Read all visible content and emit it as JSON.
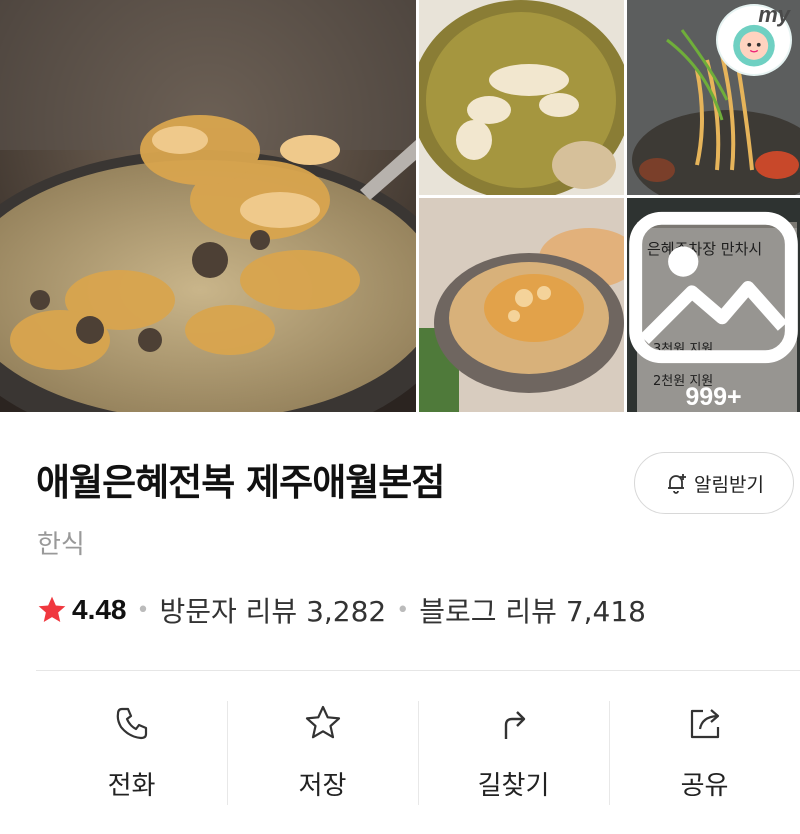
{
  "photos": {
    "more_count": "999+",
    "badge_text": "my",
    "sign_lines": [
      "은혜주차장 만차시",
      "3천원 지원",
      "2천원 지원"
    ]
  },
  "place": {
    "name": "애월은혜전복 제주애월본점",
    "category": "한식",
    "rating": "4.48",
    "visitor_reviews": "방문자 리뷰 3,282",
    "blog_reviews": "블로그 리뷰 7,418"
  },
  "alarm_button": {
    "label": "알림받기",
    "icon": "bell-plus-icon"
  },
  "actions": [
    {
      "label": "전화",
      "icon": "phone-icon"
    },
    {
      "label": "저장",
      "icon": "star-outline-icon"
    },
    {
      "label": "길찾기",
      "icon": "direction-arrow-icon"
    },
    {
      "label": "공유",
      "icon": "share-icon"
    }
  ],
  "colors": {
    "star": "#f0383f",
    "muted_text": "#999999",
    "divider": "#e6e6e6"
  }
}
